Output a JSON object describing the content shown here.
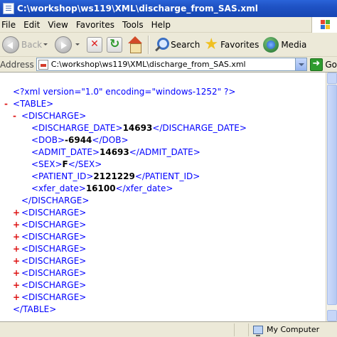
{
  "window": {
    "title": "C:\\workshop\\ws119\\XML\\discharge_from_SAS.xml"
  },
  "menu": {
    "items": [
      "File",
      "Edit",
      "View",
      "Favorites",
      "Tools",
      "Help"
    ]
  },
  "toolbar": {
    "back_label": "Back",
    "search_label": "Search",
    "favorites_label": "Favorites",
    "media_label": "Media"
  },
  "address": {
    "label": "Address",
    "value": "C:\\workshop\\ws119\\XML\\discharge_from_SAS.xml",
    "go_label": "Go"
  },
  "xml": {
    "declaration": "<?xml version=\"1.0\" encoding=\"windows-1252\" ?>",
    "minus": "-",
    "plus": "+",
    "table_open": "<TABLE>",
    "table_close": "</TABLE>",
    "discharge_open": "<DISCHARGE>",
    "discharge_close": "</DISCHARGE>",
    "fields": [
      {
        "open": "<DISCHARGE_DATE>",
        "value": "14693",
        "close": "</DISCHARGE_DATE>"
      },
      {
        "open": "<DOB>",
        "value": "-6944",
        "close": "</DOB>"
      },
      {
        "open": "<ADMIT_DATE>",
        "value": "14693",
        "close": "</ADMIT_DATE>"
      },
      {
        "open": "<SEX>",
        "value": "F",
        "close": "</SEX>"
      },
      {
        "open": "<PATIENT_ID>",
        "value": "2121229",
        "close": "</PATIENT_ID>"
      },
      {
        "open": "<xfer_date>",
        "value": "16100",
        "close": "</xfer_date>"
      }
    ],
    "collapsed_count": 8
  },
  "status": {
    "zone": "My Computer"
  },
  "colors": {
    "tag_blue": "#0000ff",
    "tag_name_maroon": "#990000",
    "toggle_red": "#dd1111",
    "titlebar_blue": "#1f52c4"
  }
}
